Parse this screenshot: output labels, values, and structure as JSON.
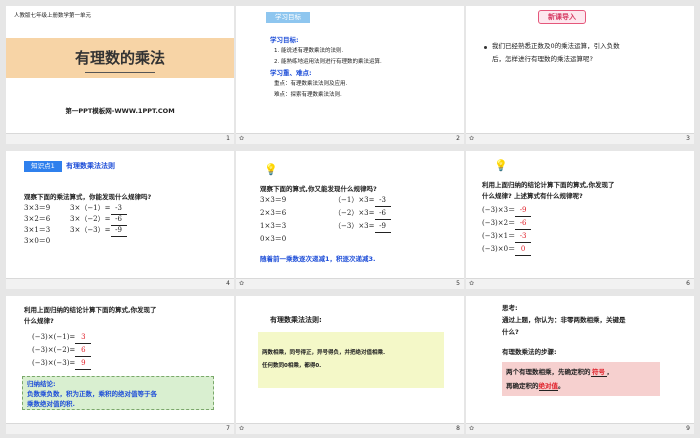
{
  "colors": {
    "accent_blue": "#2f80ed",
    "title_band": "#f7d4a6",
    "answer_red": "#e0202a",
    "rule_blue": "#1f4fd8",
    "green_box": "#d9efd0",
    "yellow_box": "#f4f8c8",
    "pink_box": "#f6d0cf"
  },
  "slide1": {
    "header": "人教版七年级上册数学第一单元",
    "title": "有理数的乘法",
    "subtitle": "第一PPT模板网-WWW.1PPT.COM",
    "num": "1"
  },
  "slide2": {
    "badge": "学习目标",
    "h1": "学习目标:",
    "i1": "1.  能说述有理数乘法的法则.",
    "i2": "2.  能熟练地运用法则进行有理数的乘法运算.",
    "h2": "学习重、难点:",
    "key": "重点：有理数乘法法则及应用.",
    "diff": "难点：探索有理数乘法法则.",
    "num": "2"
  },
  "slide3": {
    "badge": "新课导入",
    "bullet_icon": "bullet-dot-icon",
    "q1": "我们已经熟悉正数及0的乘法运算，引入负数",
    "q2": "后，怎样进行有理数的乘法运算呢?",
    "num": "3"
  },
  "slide4": {
    "tag": "知识点1",
    "heading": "有理数乘法法则",
    "q": "观察下面的乘法算式，你能发现什么规律吗?",
    "left": [
      "3×3＝9",
      "3×2＝6",
      "3×1＝3",
      "3×0＝0"
    ],
    "right": [
      "3×（−1）=",
      "3×（−2）=",
      "3×（−3）="
    ],
    "answers": [
      "-3",
      "-6",
      "-9"
    ],
    "num": "4"
  },
  "slide5": {
    "q": "观察下面的算式,你又能发现什么规律吗?",
    "left": [
      "3×3＝9",
      "2×3＝6",
      "1×3＝3",
      "0×3＝0"
    ],
    "right": [
      "（−1）×3=",
      "（−2）×3=",
      "（−3）×3="
    ],
    "answers": [
      "-3",
      "-6",
      "-9"
    ],
    "rule": "随着前一乘数逐次递减1，积逐次递减3.",
    "num": "5"
  },
  "slide6": {
    "q1": "利用上面归纳的结论计算下面的算式,你发现了",
    "q2": "什么规律?       上述算式有什么规律呢?",
    "rows": [
      "(−3)×3＝",
      "(−3)×2＝",
      "(−3)×1＝",
      "(−3)×0＝"
    ],
    "answers": [
      "-9",
      "-6",
      "-3",
      "0"
    ],
    "num": "6"
  },
  "slide7": {
    "q1": "利用上面归纳的结论计算下面的算式,你发现了",
    "q2": "什么规律?",
    "rows": [
      "(−3)×(−1)=",
      "(−3)×(−2)=",
      "(−3)×(−3)="
    ],
    "answers": [
      "3",
      "6",
      "9"
    ],
    "conc_title": "归纳结论:",
    "conc1": "负数乘负数，积为正数，乘积的绝对值等于各",
    "conc2": "乘数绝对值的积.",
    "num": "7"
  },
  "slide8": {
    "heading": "有理数乘法法则:",
    "rule1": "两数相乘，同号得正，异号得负，并把绝对值相乘.",
    "rule2": "任何数同0相乘，都得0.",
    "num": "8"
  },
  "slide9": {
    "think": "思考:",
    "q1": "通过上题，你认为：非零两数相乘，关键是",
    "q2": "什么?",
    "steps": "有理数乘法的步骤:",
    "s1a": "两个有理数相乘，先确定积的",
    "s1ans": "符号",
    "s1b": "，",
    "s2a": "再确定积的",
    "s2ans": "绝对值",
    "s2b": "。",
    "num": "9"
  },
  "star_icon": "star-icon",
  "bulb_icon": "lightbulb-icon"
}
